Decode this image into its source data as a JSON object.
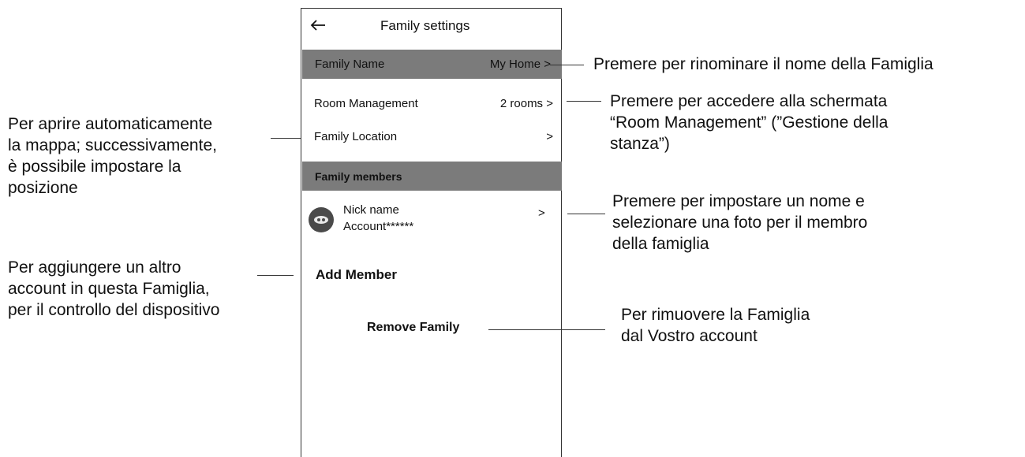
{
  "screen": {
    "title": "Family settings",
    "family_name_label": "Family Name",
    "family_name_value": "My Home >",
    "room_management_label": "Room Management",
    "room_management_value": "2 rooms >",
    "family_location_label": "Family Location",
    "family_location_value": ">",
    "family_members_header": "Family members",
    "member": {
      "nick_name": "Nick name",
      "account": "Account******",
      "arrow": ">"
    },
    "add_member_label": "Add Member",
    "remove_family_label": "Remove Family"
  },
  "annotations": {
    "rename_family": "Premere per rinominare il nome della Famiglia",
    "room_management": [
      "Premere per accedere alla schermata",
      "“Room Management” (”Gestione della",
      "stanza”)"
    ],
    "location": [
      "Per aprire automaticamente",
      "la mappa; successivamente,",
      "è possibile impostare la",
      "posizione"
    ],
    "member_settings": [
      "Premere per impostare un nome e",
      "selezionare una foto per il membro",
      "della famiglia"
    ],
    "add_member": [
      "Per aggiungere un altro",
      "account in questa Famiglia,",
      "per il controllo del dispositivo"
    ],
    "remove_family": [
      "Per rimuovere la Famiglia",
      "dal Vostro account"
    ]
  },
  "icons": {
    "back": "back-arrow-icon",
    "avatar": "user-avatar-icon"
  },
  "colors": {
    "header_bar": "#7b7b7b",
    "avatar": "#4a4a4a"
  }
}
